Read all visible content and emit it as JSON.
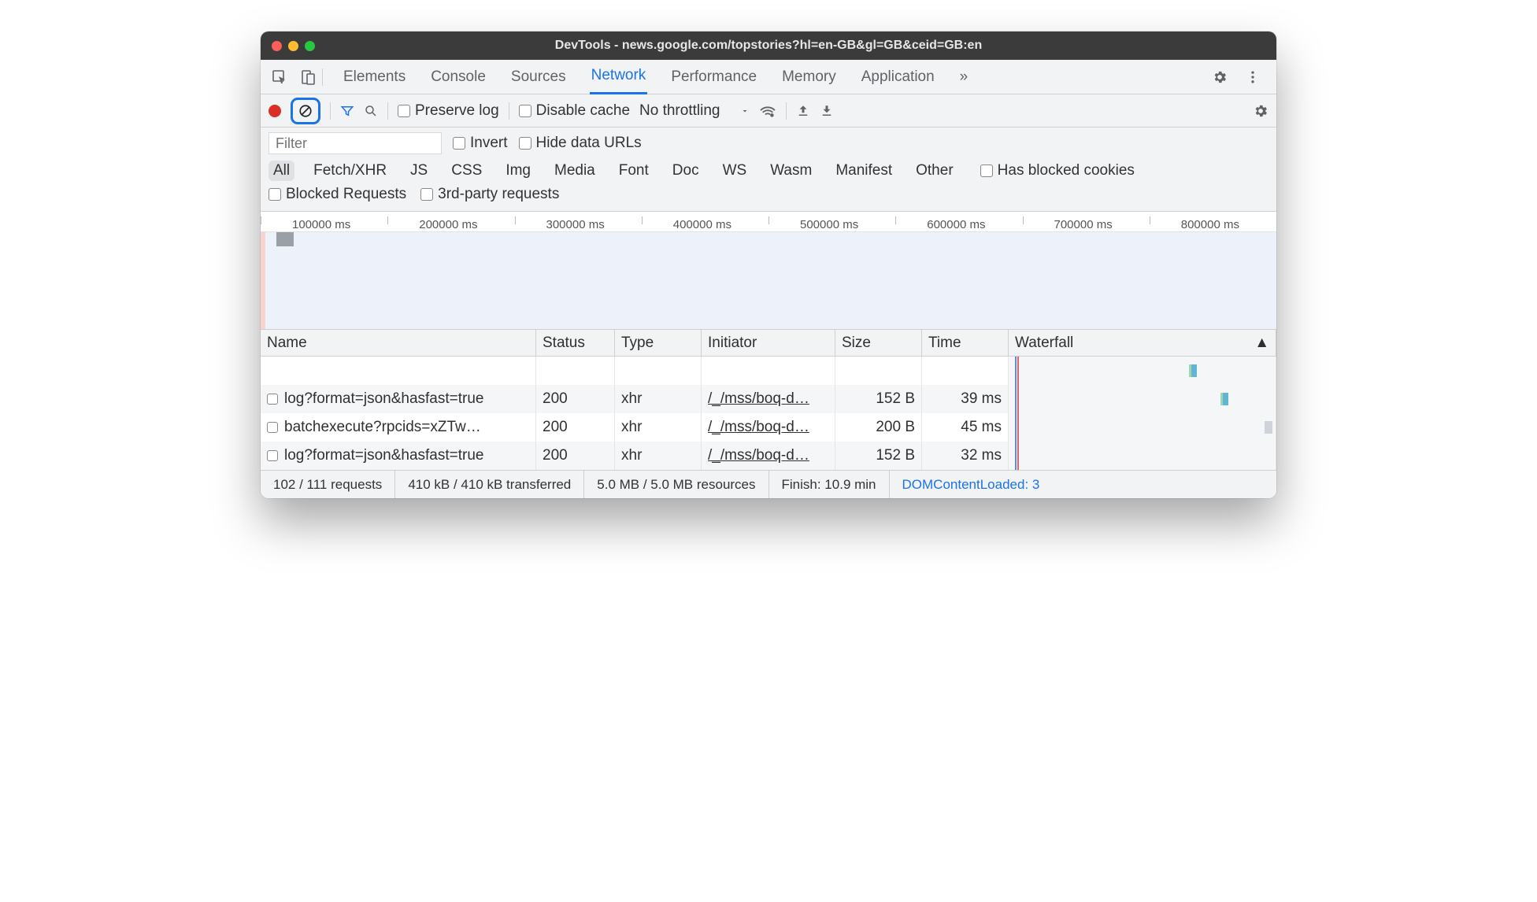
{
  "window": {
    "title": "DevTools - news.google.com/topstories?hl=en-GB&gl=GB&ceid=GB:en"
  },
  "tabs": {
    "items": [
      "Elements",
      "Console",
      "Sources",
      "Network",
      "Performance",
      "Memory",
      "Application"
    ],
    "more": "»",
    "active": "Network"
  },
  "toolbar": {
    "preserve_log": "Preserve log",
    "disable_cache": "Disable cache",
    "throttling": "No throttling"
  },
  "filter": {
    "placeholder": "Filter",
    "invert": "Invert",
    "hide_data_urls": "Hide data URLs"
  },
  "type_filters": [
    "All",
    "Fetch/XHR",
    "JS",
    "CSS",
    "Img",
    "Media",
    "Font",
    "Doc",
    "WS",
    "Wasm",
    "Manifest",
    "Other"
  ],
  "type_filters_active": "All",
  "extra_filters": {
    "has_blocked_cookies": "Has blocked cookies",
    "blocked_requests": "Blocked Requests",
    "third_party": "3rd-party requests"
  },
  "timeline": {
    "ticks": [
      "100000 ms",
      "200000 ms",
      "300000 ms",
      "400000 ms",
      "500000 ms",
      "600000 ms",
      "700000 ms",
      "800000 ms"
    ]
  },
  "columns": {
    "name": "Name",
    "status": "Status",
    "type": "Type",
    "initiator": "Initiator",
    "size": "Size",
    "time": "Time",
    "waterfall": "Waterfall"
  },
  "rows": [
    {
      "name": "log?format=json&hasfast=true",
      "status": "200",
      "type": "xhr",
      "initiator": "/_/mss/boq-d…",
      "size": "152 B",
      "time": "39 ms"
    },
    {
      "name": "batchexecute?rpcids=xZTw…",
      "status": "200",
      "type": "xhr",
      "initiator": "/_/mss/boq-d…",
      "size": "200 B",
      "time": "45 ms"
    },
    {
      "name": "log?format=json&hasfast=true",
      "status": "200",
      "type": "xhr",
      "initiator": "/_/mss/boq-d…",
      "size": "152 B",
      "time": "32 ms"
    }
  ],
  "status": {
    "requests": "102 / 111 requests",
    "transferred": "410 kB / 410 kB transferred",
    "resources": "5.0 MB / 5.0 MB resources",
    "finish": "Finish: 10.9 min",
    "dcl": "DOMContentLoaded: 3"
  }
}
